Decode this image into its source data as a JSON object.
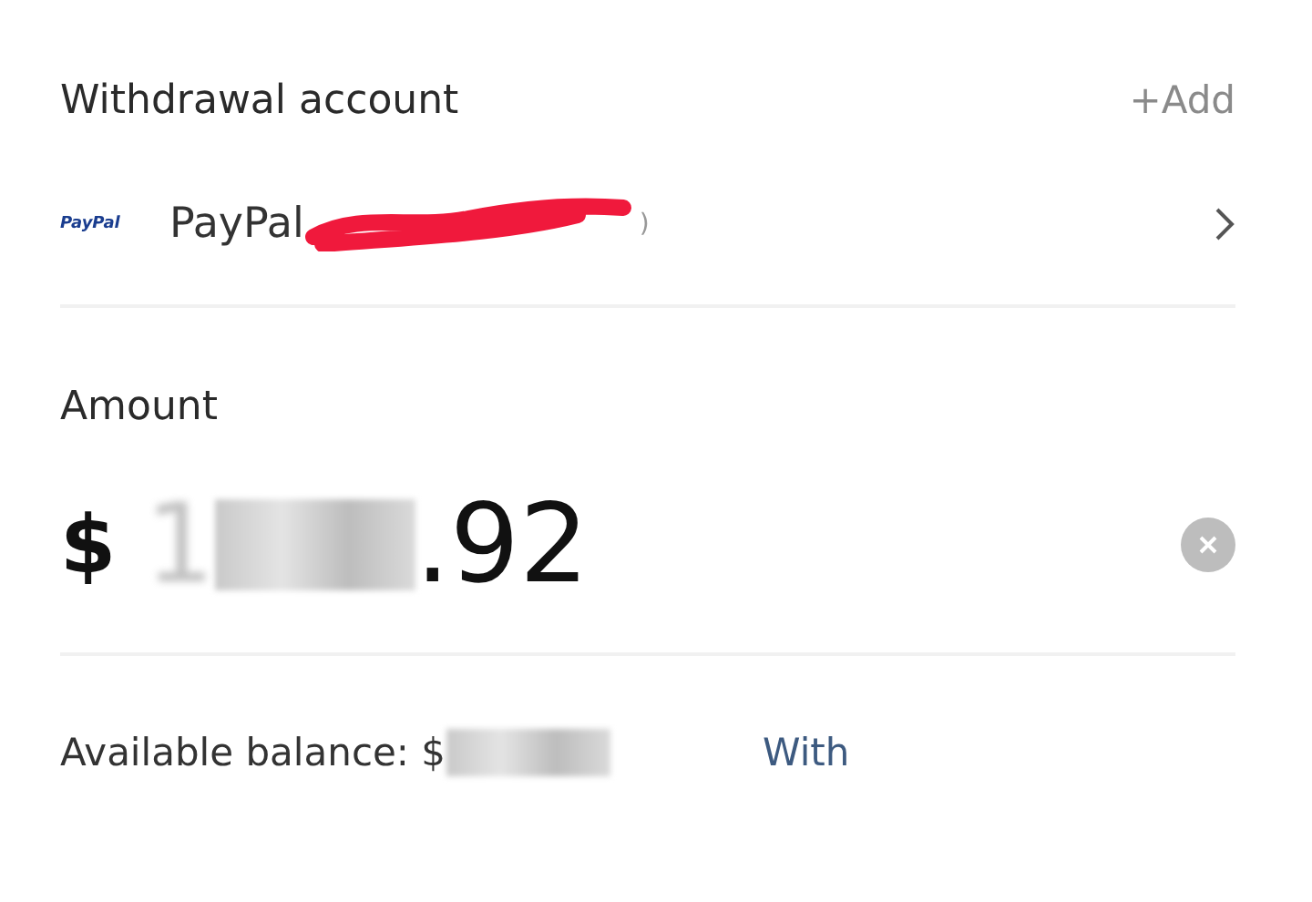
{
  "account_section": {
    "title": "Withdrawal account",
    "add_link": "+Add"
  },
  "account": {
    "logo_text": "PayPal",
    "name": "PayPal",
    "trailing": ")"
  },
  "amount_section": {
    "title": "Amount",
    "currency": "$",
    "leading_digit": "1",
    "value": ".92"
  },
  "footer": {
    "balance_label": "Available balance: $",
    "action": "With"
  }
}
